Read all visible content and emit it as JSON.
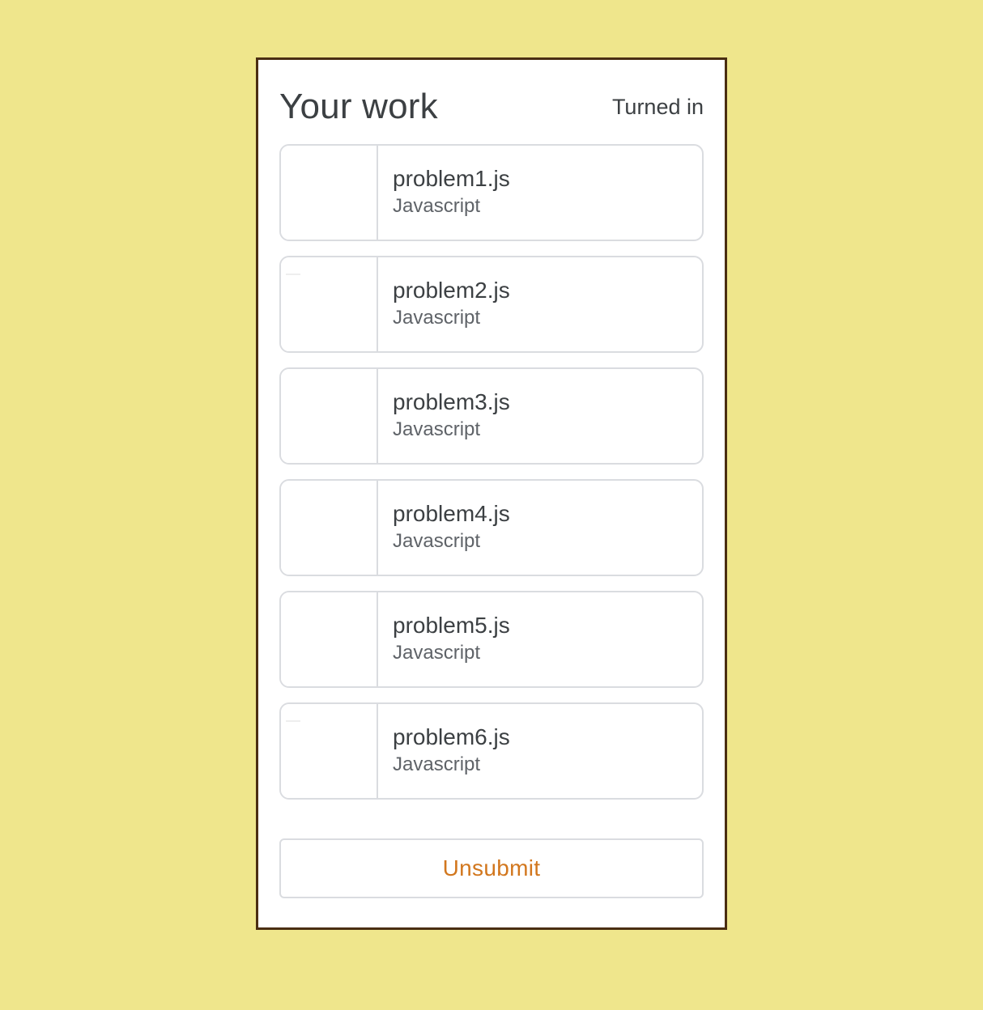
{
  "header": {
    "title": "Your work",
    "status": "Turned in"
  },
  "files": [
    {
      "name": "problem1.js",
      "type": "Javascript"
    },
    {
      "name": "problem2.js",
      "type": "Javascript"
    },
    {
      "name": "problem3.js",
      "type": "Javascript"
    },
    {
      "name": "problem4.js",
      "type": "Javascript"
    },
    {
      "name": "problem5.js",
      "type": "Javascript"
    },
    {
      "name": "problem6.js",
      "type": "Javascript"
    }
  ],
  "actions": {
    "unsubmit_label": "Unsubmit"
  },
  "colors": {
    "page_background": "#efe68c",
    "panel_border": "#4a2e12",
    "unsubmit_text": "#d2771e"
  }
}
